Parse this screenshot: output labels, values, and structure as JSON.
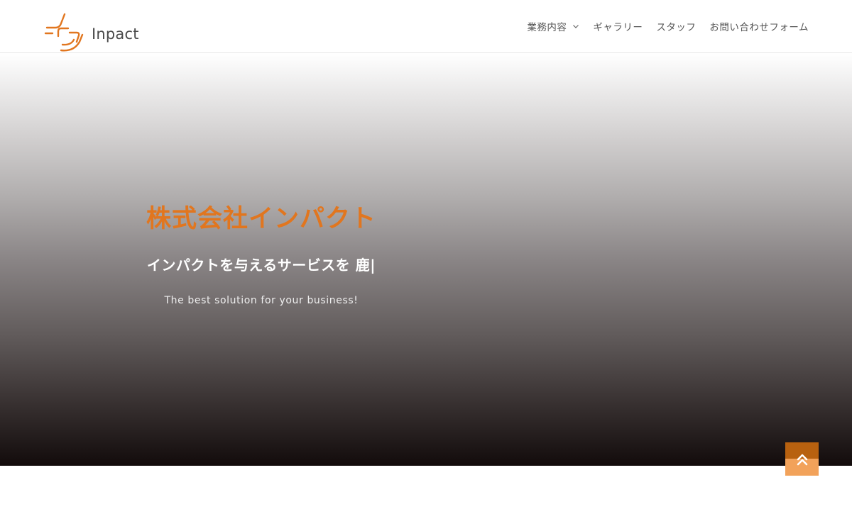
{
  "brand": {
    "name": "Inpact",
    "accent_color": "#e1761f"
  },
  "nav": {
    "items": [
      {
        "label": "業務内容",
        "has_dropdown": true,
        "icon": "chevron-down-icon"
      },
      {
        "label": "ギャラリー"
      },
      {
        "label": "スタッフ"
      },
      {
        "label": "お問い合わせフォーム"
      }
    ]
  },
  "hero": {
    "title": "株式会社インパクト",
    "subtitle": "インパクトを与えるサービスを 鹿|",
    "tagline": "The best solution for your business!"
  },
  "back_to_top": {
    "icon": "double-chevron-up-icon",
    "color": "#f2a25a"
  }
}
